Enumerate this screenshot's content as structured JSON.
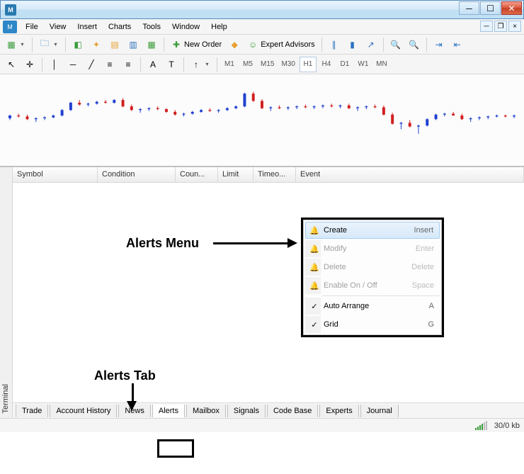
{
  "window": {
    "title": ""
  },
  "menubar": [
    "File",
    "View",
    "Insert",
    "Charts",
    "Tools",
    "Window",
    "Help"
  ],
  "toolbar1": {
    "new_order": "New Order",
    "expert_advisors": "Expert Advisors"
  },
  "timeframes": [
    "M1",
    "M5",
    "M15",
    "M30",
    "H1",
    "H4",
    "D1",
    "W1",
    "MN"
  ],
  "active_timeframe": "H1",
  "terminal": {
    "side_label": "Terminal",
    "columns": {
      "symbol": "Symbol",
      "condition": "Condition",
      "coun": "Coun...",
      "limit": "Limit",
      "timeo": "Timeo...",
      "event": "Event"
    },
    "tabs": [
      "Trade",
      "Account History",
      "News",
      "Alerts",
      "Mailbox",
      "Signals",
      "Code Base",
      "Experts",
      "Journal"
    ],
    "active_tab": "Alerts"
  },
  "context_menu": {
    "items": [
      {
        "label": "Create",
        "shortcut": "Insert",
        "enabled": true,
        "highlight": true,
        "icon": "bell-plus"
      },
      {
        "label": "Modify",
        "shortcut": "Enter",
        "enabled": false,
        "icon": "bell-edit"
      },
      {
        "label": "Delete",
        "shortcut": "Delete",
        "enabled": false,
        "icon": "bell-x"
      },
      {
        "label": "Enable On / Off",
        "shortcut": "Space",
        "enabled": false,
        "icon": "bell"
      }
    ],
    "items2": [
      {
        "label": "Auto Arrange",
        "shortcut": "A",
        "checked": true
      },
      {
        "label": "Grid",
        "shortcut": "G",
        "checked": true
      }
    ]
  },
  "statusbar": {
    "conn": "30/0 kb"
  },
  "annotations": {
    "alerts_menu": "Alerts Menu",
    "alerts_tab": "Alerts Tab"
  },
  "chart_data": {
    "type": "candlestick",
    "note": "approximate candle sequence read from screenshot; prices normalized 0-100 (no axis labels visible)",
    "candles": [
      {
        "o": 52,
        "h": 56,
        "l": 50,
        "c": 55,
        "dir": "up"
      },
      {
        "o": 55,
        "h": 57,
        "l": 53,
        "c": 54,
        "dir": "down"
      },
      {
        "o": 54,
        "h": 56,
        "l": 50,
        "c": 51,
        "dir": "down"
      },
      {
        "o": 51,
        "h": 53,
        "l": 48,
        "c": 52,
        "dir": "up"
      },
      {
        "o": 52,
        "h": 54,
        "l": 50,
        "c": 53,
        "dir": "up"
      },
      {
        "o": 53,
        "h": 56,
        "l": 52,
        "c": 55,
        "dir": "up"
      },
      {
        "o": 55,
        "h": 62,
        "l": 54,
        "c": 61,
        "dir": "up"
      },
      {
        "o": 61,
        "h": 70,
        "l": 60,
        "c": 69,
        "dir": "up"
      },
      {
        "o": 69,
        "h": 72,
        "l": 66,
        "c": 67,
        "dir": "down"
      },
      {
        "o": 67,
        "h": 69,
        "l": 65,
        "c": 68,
        "dir": "up"
      },
      {
        "o": 68,
        "h": 71,
        "l": 67,
        "c": 70,
        "dir": "up"
      },
      {
        "o": 70,
        "h": 72,
        "l": 68,
        "c": 69,
        "dir": "down"
      },
      {
        "o": 69,
        "h": 73,
        "l": 68,
        "c": 72,
        "dir": "up"
      },
      {
        "o": 72,
        "h": 74,
        "l": 64,
        "c": 65,
        "dir": "down"
      },
      {
        "o": 65,
        "h": 67,
        "l": 60,
        "c": 61,
        "dir": "down"
      },
      {
        "o": 61,
        "h": 63,
        "l": 58,
        "c": 62,
        "dir": "up"
      },
      {
        "o": 62,
        "h": 64,
        "l": 60,
        "c": 63,
        "dir": "up"
      },
      {
        "o": 63,
        "h": 65,
        "l": 61,
        "c": 62,
        "dir": "down"
      },
      {
        "o": 62,
        "h": 63,
        "l": 58,
        "c": 59,
        "dir": "down"
      },
      {
        "o": 59,
        "h": 61,
        "l": 55,
        "c": 56,
        "dir": "down"
      },
      {
        "o": 56,
        "h": 58,
        "l": 54,
        "c": 57,
        "dir": "up"
      },
      {
        "o": 57,
        "h": 60,
        "l": 56,
        "c": 59,
        "dir": "up"
      },
      {
        "o": 59,
        "h": 62,
        "l": 58,
        "c": 61,
        "dir": "up"
      },
      {
        "o": 61,
        "h": 63,
        "l": 59,
        "c": 60,
        "dir": "down"
      },
      {
        "o": 60,
        "h": 62,
        "l": 58,
        "c": 61,
        "dir": "up"
      },
      {
        "o": 61,
        "h": 64,
        "l": 60,
        "c": 63,
        "dir": "up"
      },
      {
        "o": 63,
        "h": 66,
        "l": 62,
        "c": 65,
        "dir": "up"
      },
      {
        "o": 65,
        "h": 80,
        "l": 64,
        "c": 79,
        "dir": "up"
      },
      {
        "o": 79,
        "h": 81,
        "l": 70,
        "c": 71,
        "dir": "down"
      },
      {
        "o": 71,
        "h": 73,
        "l": 62,
        "c": 63,
        "dir": "down"
      },
      {
        "o": 63,
        "h": 65,
        "l": 60,
        "c": 64,
        "dir": "up"
      },
      {
        "o": 64,
        "h": 66,
        "l": 62,
        "c": 63,
        "dir": "down"
      },
      {
        "o": 63,
        "h": 65,
        "l": 61,
        "c": 64,
        "dir": "up"
      },
      {
        "o": 64,
        "h": 66,
        "l": 62,
        "c": 65,
        "dir": "up"
      },
      {
        "o": 65,
        "h": 67,
        "l": 63,
        "c": 64,
        "dir": "down"
      },
      {
        "o": 64,
        "h": 66,
        "l": 62,
        "c": 65,
        "dir": "up"
      },
      {
        "o": 65,
        "h": 67,
        "l": 63,
        "c": 66,
        "dir": "up"
      },
      {
        "o": 66,
        "h": 68,
        "l": 64,
        "c": 65,
        "dir": "down"
      },
      {
        "o": 65,
        "h": 67,
        "l": 63,
        "c": 66,
        "dir": "up"
      },
      {
        "o": 66,
        "h": 68,
        "l": 62,
        "c": 63,
        "dir": "down"
      },
      {
        "o": 63,
        "h": 65,
        "l": 60,
        "c": 64,
        "dir": "up"
      },
      {
        "o": 64,
        "h": 66,
        "l": 62,
        "c": 65,
        "dir": "up"
      },
      {
        "o": 65,
        "h": 67,
        "l": 63,
        "c": 64,
        "dir": "down"
      },
      {
        "o": 64,
        "h": 66,
        "l": 55,
        "c": 56,
        "dir": "down"
      },
      {
        "o": 56,
        "h": 58,
        "l": 45,
        "c": 46,
        "dir": "down"
      },
      {
        "o": 46,
        "h": 48,
        "l": 40,
        "c": 47,
        "dir": "up"
      },
      {
        "o": 47,
        "h": 50,
        "l": 42,
        "c": 43,
        "dir": "down"
      },
      {
        "o": 43,
        "h": 45,
        "l": 35,
        "c": 44,
        "dir": "up"
      },
      {
        "o": 44,
        "h": 52,
        "l": 43,
        "c": 51,
        "dir": "up"
      },
      {
        "o": 51,
        "h": 57,
        "l": 50,
        "c": 56,
        "dir": "up"
      },
      {
        "o": 56,
        "h": 58,
        "l": 54,
        "c": 57,
        "dir": "up"
      },
      {
        "o": 57,
        "h": 59,
        "l": 55,
        "c": 55,
        "dir": "down"
      },
      {
        "o": 55,
        "h": 57,
        "l": 50,
        "c": 51,
        "dir": "down"
      },
      {
        "o": 51,
        "h": 53,
        "l": 48,
        "c": 52,
        "dir": "up"
      },
      {
        "o": 52,
        "h": 54,
        "l": 50,
        "c": 53,
        "dir": "up"
      },
      {
        "o": 53,
        "h": 55,
        "l": 51,
        "c": 54,
        "dir": "up"
      },
      {
        "o": 54,
        "h": 56,
        "l": 53,
        "c": 55,
        "dir": "up"
      },
      {
        "o": 55,
        "h": 56,
        "l": 53,
        "c": 54,
        "dir": "down"
      },
      {
        "o": 54,
        "h": 56,
        "l": 52,
        "c": 55,
        "dir": "up"
      }
    ]
  }
}
